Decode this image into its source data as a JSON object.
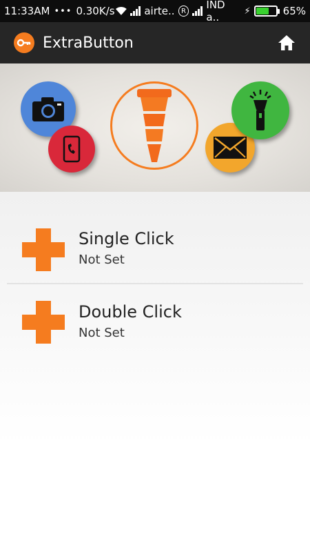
{
  "status_bar": {
    "time": "11:33AM",
    "net_speed": "0.30K/s",
    "carrier1": "airte..",
    "carrier2": "IND a..",
    "roaming_symbol": "R",
    "battery_percent": "65%",
    "battery_level": 0.65,
    "icons": [
      "dots-icon",
      "wifi-icon",
      "signal-icon",
      "roaming-icon",
      "signal-icon",
      "charging-icon",
      "battery-icon"
    ]
  },
  "app_bar": {
    "title": "ExtraButton",
    "logo_icon": "key-icon",
    "home_icon": "home-icon"
  },
  "banner": {
    "icons": [
      "camera-icon",
      "phone-icon",
      "extra-button-plug-icon",
      "mail-icon",
      "flashlight-icon"
    ]
  },
  "list": {
    "items": [
      {
        "title": "Single Click",
        "subtitle": "Not Set",
        "icon": "plus-icon"
      },
      {
        "title": "Double Click",
        "subtitle": "Not Set",
        "icon": "plus-icon"
      }
    ]
  },
  "colors": {
    "accent": "#f57c1f",
    "camera_circle": "#4f86d9",
    "phone_circle": "#d9283a",
    "mail_circle": "#f2a62c",
    "flashlight_circle": "#40b640",
    "battery": "#39d12f"
  }
}
